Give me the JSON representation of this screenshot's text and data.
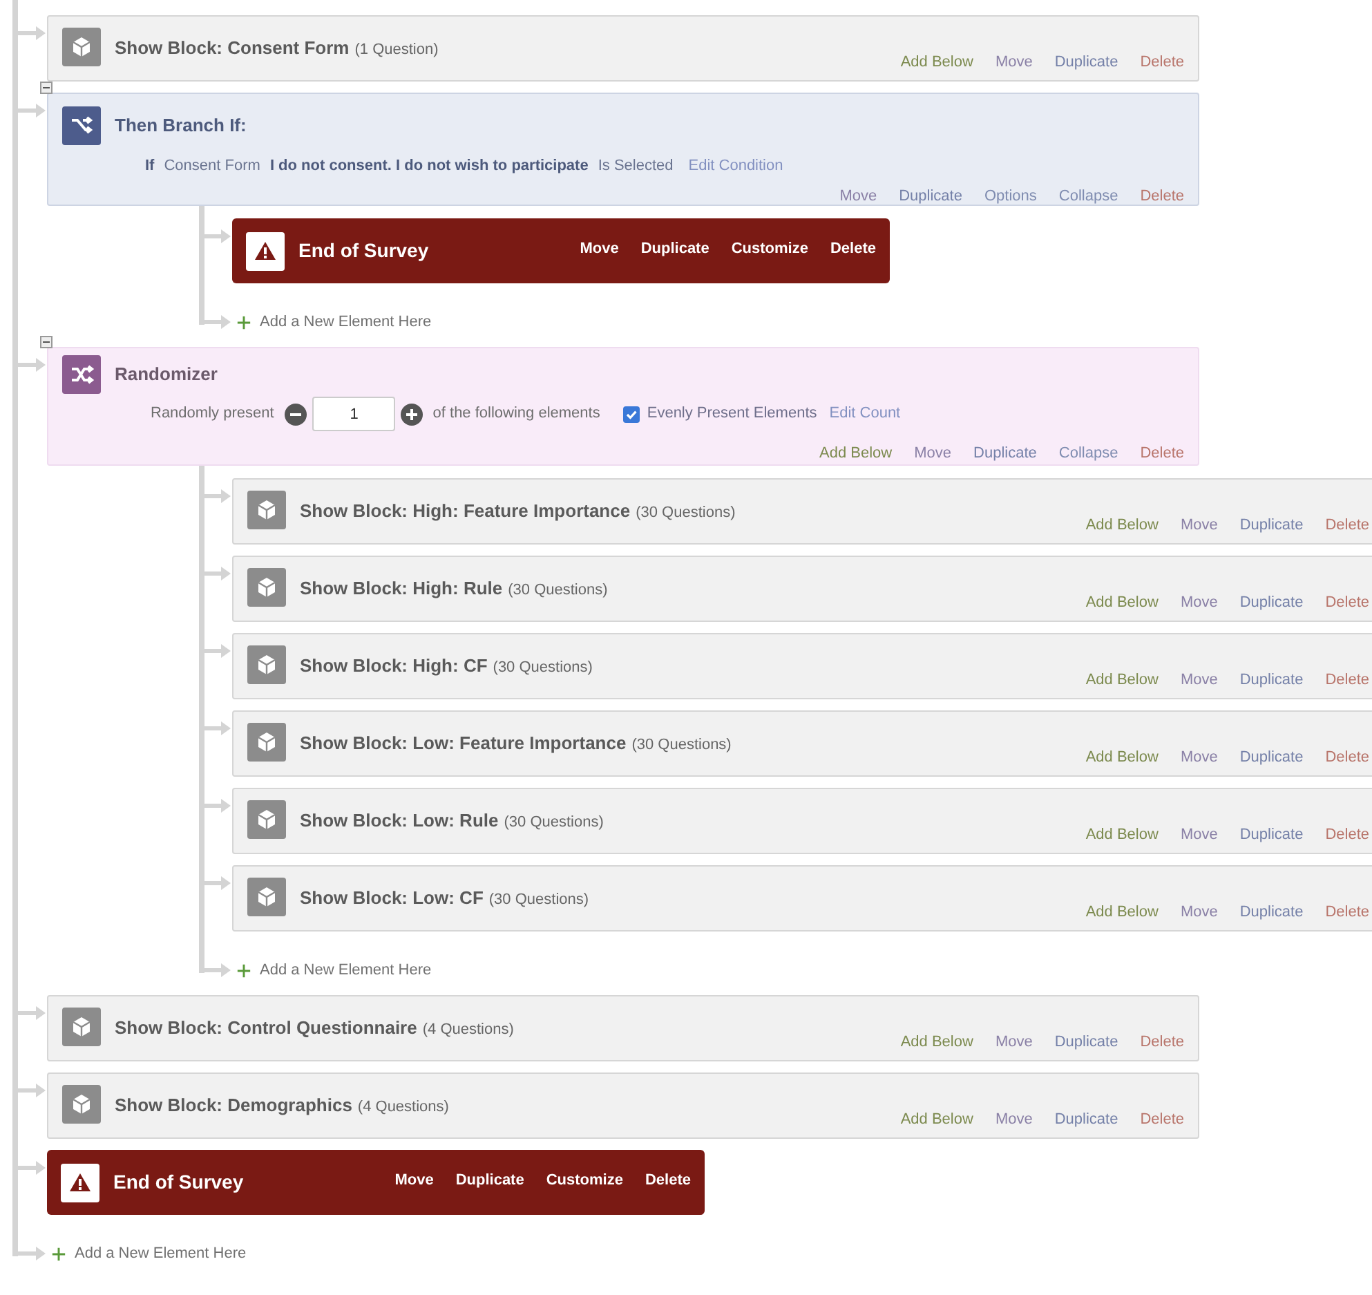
{
  "flow": [
    {
      "kind": "block",
      "title": "Show Block: Consent Form",
      "count": "(1 Question)",
      "actions": [
        {
          "label": "Add Below",
          "kind": "add-below"
        },
        {
          "label": "Move",
          "kind": "move"
        },
        {
          "label": "Duplicate",
          "kind": "duplicate"
        },
        {
          "label": "Delete",
          "kind": "delete"
        }
      ]
    },
    {
      "kind": "branch",
      "title": "Then Branch If:",
      "expanded": true,
      "condition": {
        "prefix": "If",
        "question": "Consent Form",
        "choice": "I do not consent. I do not wish to participate",
        "operator": "Is Selected",
        "edit": "Edit Condition"
      },
      "actions": [
        {
          "label": "Move",
          "kind": "move"
        },
        {
          "label": "Duplicate",
          "kind": "duplicate"
        },
        {
          "label": "Options",
          "kind": "options"
        },
        {
          "label": "Collapse",
          "kind": "collapse"
        },
        {
          "label": "Delete",
          "kind": "delete"
        }
      ],
      "children": [
        {
          "kind": "end",
          "title": "End of Survey",
          "actions": [
            {
              "label": "Move",
              "kind": "move"
            },
            {
              "label": "Duplicate",
              "kind": "duplicate"
            },
            {
              "label": "Customize",
              "kind": "customize"
            },
            {
              "label": "Delete",
              "kind": "delete"
            }
          ]
        },
        {
          "kind": "add",
          "label": "Add a New Element Here"
        }
      ]
    },
    {
      "kind": "randomizer",
      "title": "Randomizer",
      "expanded": true,
      "present_label": "Randomly present",
      "count_value": "1",
      "following_label": "of the following elements",
      "evenly": {
        "label": "Evenly Present Elements",
        "checked": true
      },
      "edit": "Edit Count",
      "actions": [
        {
          "label": "Add Below",
          "kind": "add-below"
        },
        {
          "label": "Move",
          "kind": "move"
        },
        {
          "label": "Duplicate",
          "kind": "duplicate"
        },
        {
          "label": "Collapse",
          "kind": "collapse"
        },
        {
          "label": "Delete",
          "kind": "delete"
        }
      ],
      "children": [
        {
          "kind": "block",
          "title": "Show Block: High: Feature Importance",
          "count": "(30 Questions)",
          "actions": [
            {
              "label": "Add Below",
              "kind": "add-below"
            },
            {
              "label": "Move",
              "kind": "move"
            },
            {
              "label": "Duplicate",
              "kind": "duplicate"
            },
            {
              "label": "Delete",
              "kind": "delete"
            }
          ]
        },
        {
          "kind": "block",
          "title": "Show Block: High: Rule",
          "count": "(30 Questions)",
          "actions": [
            {
              "label": "Add Below",
              "kind": "add-below"
            },
            {
              "label": "Move",
              "kind": "move"
            },
            {
              "label": "Duplicate",
              "kind": "duplicate"
            },
            {
              "label": "Delete",
              "kind": "delete"
            }
          ]
        },
        {
          "kind": "block",
          "title": "Show Block: High: CF",
          "count": "(30 Questions)",
          "actions": [
            {
              "label": "Add Below",
              "kind": "add-below"
            },
            {
              "label": "Move",
              "kind": "move"
            },
            {
              "label": "Duplicate",
              "kind": "duplicate"
            },
            {
              "label": "Delete",
              "kind": "delete"
            }
          ]
        },
        {
          "kind": "block",
          "title": "Show Block: Low: Feature Importance",
          "count": "(30 Questions)",
          "actions": [
            {
              "label": "Add Below",
              "kind": "add-below"
            },
            {
              "label": "Move",
              "kind": "move"
            },
            {
              "label": "Duplicate",
              "kind": "duplicate"
            },
            {
              "label": "Delete",
              "kind": "delete"
            }
          ]
        },
        {
          "kind": "block",
          "title": "Show Block: Low: Rule",
          "count": "(30 Questions)",
          "actions": [
            {
              "label": "Add Below",
              "kind": "add-below"
            },
            {
              "label": "Move",
              "kind": "move"
            },
            {
              "label": "Duplicate",
              "kind": "duplicate"
            },
            {
              "label": "Delete",
              "kind": "delete"
            }
          ]
        },
        {
          "kind": "block",
          "title": "Show Block: Low: CF",
          "count": "(30 Questions)",
          "actions": [
            {
              "label": "Add Below",
              "kind": "add-below"
            },
            {
              "label": "Move",
              "kind": "move"
            },
            {
              "label": "Duplicate",
              "kind": "duplicate"
            },
            {
              "label": "Delete",
              "kind": "delete"
            }
          ]
        },
        {
          "kind": "add",
          "label": "Add a New Element Here"
        }
      ]
    },
    {
      "kind": "block",
      "title": "Show Block: Control Questionnaire",
      "count": "(4 Questions)",
      "actions": [
        {
          "label": "Add Below",
          "kind": "add-below"
        },
        {
          "label": "Move",
          "kind": "move"
        },
        {
          "label": "Duplicate",
          "kind": "duplicate"
        },
        {
          "label": "Delete",
          "kind": "delete"
        }
      ]
    },
    {
      "kind": "block",
      "title": "Show Block: Demographics",
      "count": "(4 Questions)",
      "actions": [
        {
          "label": "Add Below",
          "kind": "add-below"
        },
        {
          "label": "Move",
          "kind": "move"
        },
        {
          "label": "Duplicate",
          "kind": "duplicate"
        },
        {
          "label": "Delete",
          "kind": "delete"
        }
      ]
    },
    {
      "kind": "end",
      "title": "End of Survey",
      "actions": [
        {
          "label": "Move",
          "kind": "move"
        },
        {
          "label": "Duplicate",
          "kind": "duplicate"
        },
        {
          "label": "Customize",
          "kind": "customize"
        },
        {
          "label": "Delete",
          "kind": "delete"
        }
      ]
    },
    {
      "kind": "add",
      "label": "Add a New Element Here"
    }
  ]
}
